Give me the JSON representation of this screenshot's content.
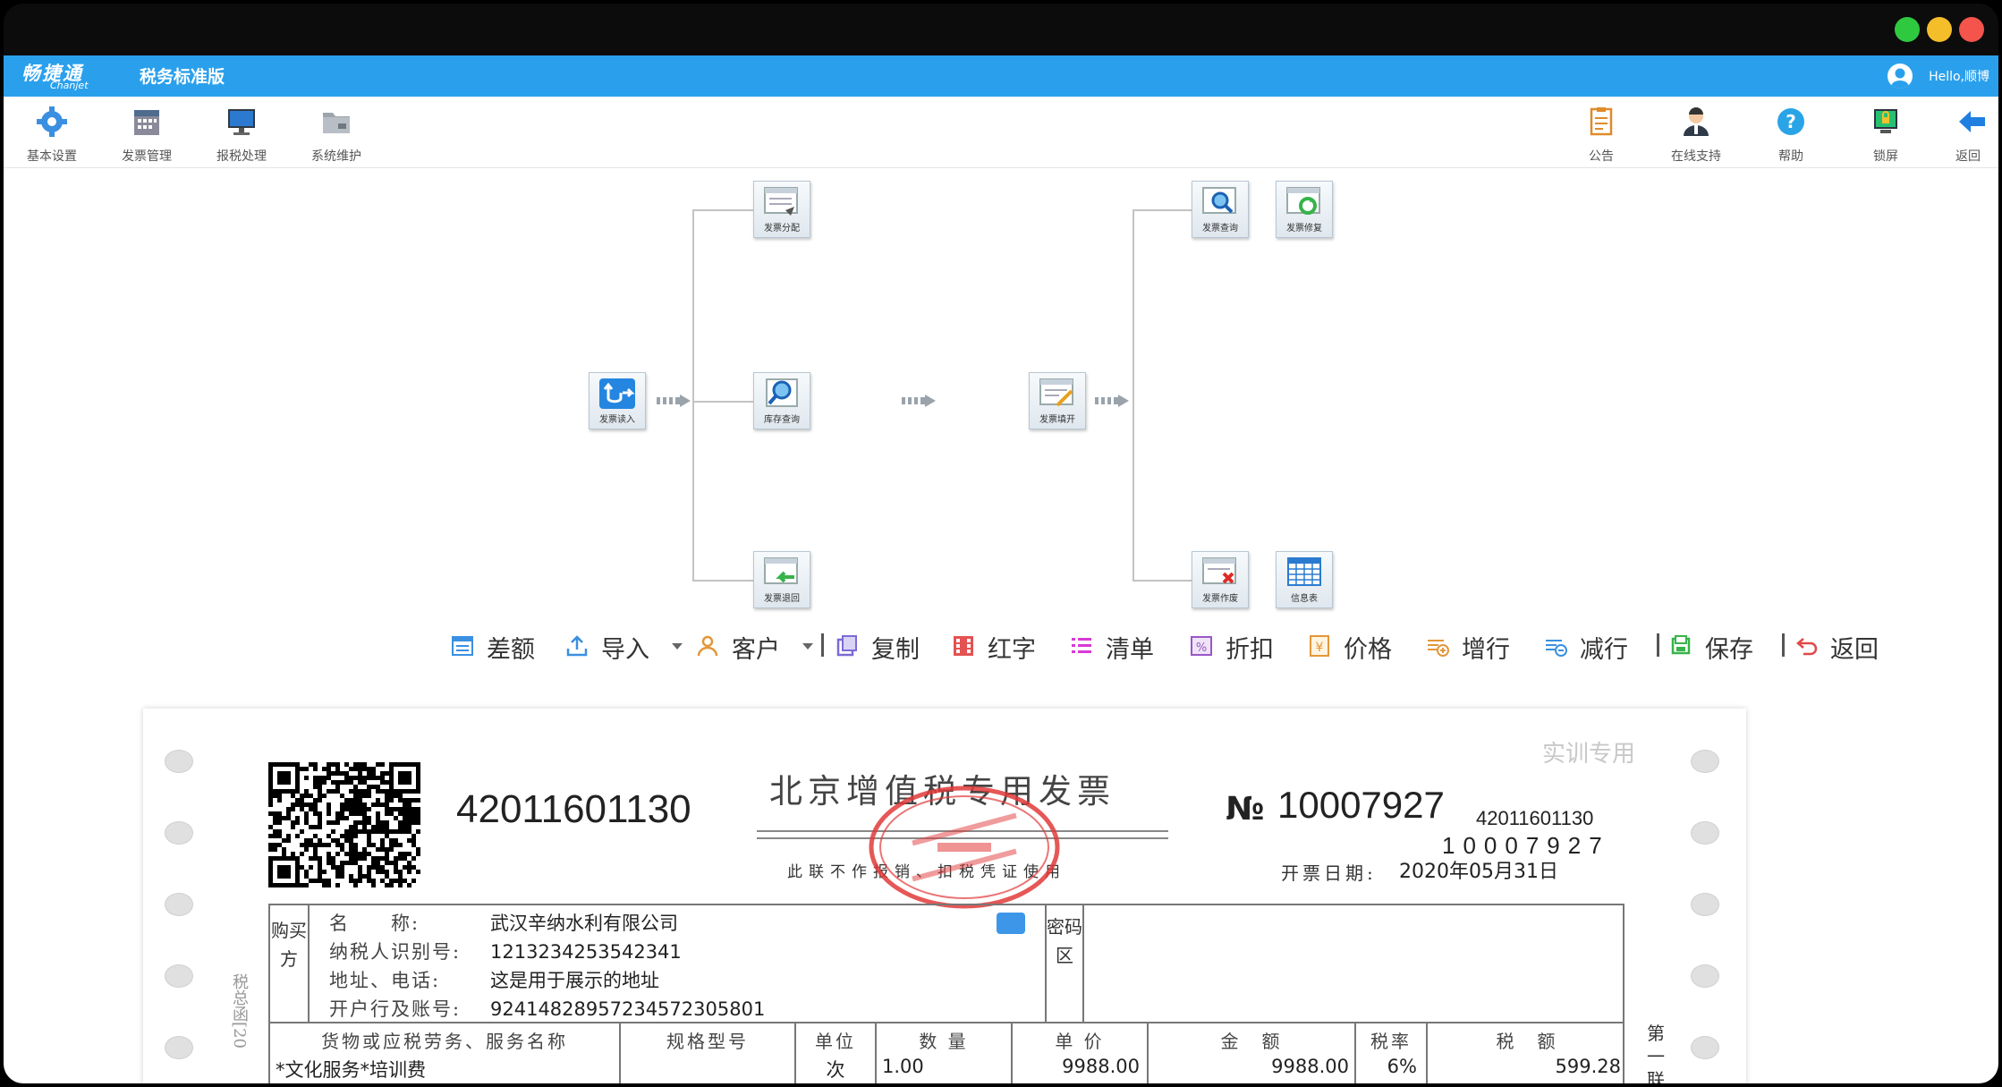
{
  "app": {
    "brand": "畅捷通",
    "brand_sub": "Chanjet",
    "edition": "税务标准版",
    "greeting": "Hello,顺博"
  },
  "toolbar": {
    "left": [
      {
        "label": "基本设置",
        "icon": "gear-icon"
      },
      {
        "label": "发票管理",
        "icon": "calendar-icon"
      },
      {
        "label": "报税处理",
        "icon": "monitor-icon"
      },
      {
        "label": "系统维护",
        "icon": "folder-icon"
      }
    ],
    "right": [
      {
        "label": "公告",
        "icon": "notice-icon"
      },
      {
        "label": "在线支持",
        "icon": "support-icon"
      },
      {
        "label": "帮助",
        "icon": "help-icon"
      },
      {
        "label": "锁屏",
        "icon": "lock-icon"
      },
      {
        "label": "返回",
        "icon": "back-arrow-icon"
      }
    ]
  },
  "flow": {
    "input": "发票读入",
    "distribute": "发票分配",
    "stock_query": "库存查询",
    "return": "发票退回",
    "fill": "发票填开",
    "query": "发票查询",
    "repair": "发票修复",
    "void": "发票作废",
    "info": "信息表"
  },
  "actions": [
    {
      "label": "差额",
      "icon": "diff-icon"
    },
    {
      "label": "导入",
      "icon": "import-icon"
    },
    {
      "label": "客户",
      "icon": "customer-icon"
    },
    {
      "label": "复制",
      "icon": "copy-icon"
    },
    {
      "label": "红字",
      "icon": "red-letter-icon"
    },
    {
      "label": "清单",
      "icon": "list-icon"
    },
    {
      "label": "折扣",
      "icon": "discount-icon"
    },
    {
      "label": "价格",
      "icon": "price-icon"
    },
    {
      "label": "增行",
      "icon": "add-row-icon"
    },
    {
      "label": "减行",
      "icon": "remove-row-icon"
    },
    {
      "label": "保存",
      "icon": "save-icon"
    },
    {
      "label": "返回",
      "icon": "return-icon"
    }
  ],
  "invoice": {
    "code": "42011601130",
    "title": "北京增值税专用发票",
    "notice": "此联不作报销、扣税凭证使用",
    "number_symbol": "№",
    "number": "10007927",
    "code_small": "42011601130",
    "number_small": "10007927",
    "date_label": "开票日期:",
    "date": "2020年05月31日",
    "watermark": "实训专用",
    "side_text": "税总函[20",
    "buyer_label": "购买方",
    "cipher_label": "密码区",
    "part_label": "第一联",
    "buyer": {
      "name_label": "名　　称:",
      "name": "武汉辛纳水利有限公司",
      "taxid_label": "纳税人识别号:",
      "taxid": "1213234253542341",
      "address_label": "地址、电话:",
      "address": "这是用于展示的地址",
      "bank_label": "开户行及账号:",
      "bank": "92414828957234572305801"
    },
    "columns": {
      "name": "货物或应税劳务、服务名称",
      "spec": "规格型号",
      "unit": "单位",
      "qty": "数 量",
      "price": "单 价",
      "amount": "金　额",
      "rate": "税率",
      "tax": "税　额"
    },
    "item": {
      "name": "*文化服务*培训费",
      "unit": "次",
      "qty": "1.00",
      "price": "9988.00",
      "amount": "9988.00",
      "rate": "6%",
      "tax": "599.28"
    }
  }
}
